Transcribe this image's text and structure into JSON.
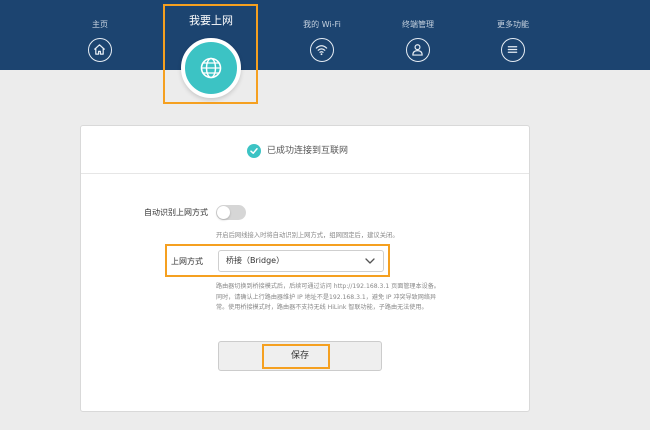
{
  "nav": {
    "items": [
      {
        "label": "主页",
        "icon": "home-icon"
      },
      {
        "label": "我的 Wi-Fi",
        "icon": "wifi-icon"
      },
      {
        "label": "终端管理",
        "icon": "user-icon"
      },
      {
        "label": "更多功能",
        "icon": "menu-icon"
      }
    ],
    "active": {
      "label": "我要上网",
      "icon": "globe-icon"
    }
  },
  "status": {
    "text": "已成功连接到互联网",
    "icon": "check-circle-icon"
  },
  "auto_detect": {
    "label": "自动识别上网方式",
    "enabled": false,
    "hint": "开启后网线接入时将自动识别上网方式，组网固定后，建议关闭。"
  },
  "mode": {
    "label": "上网方式",
    "selected": "桥接（Bridge）"
  },
  "bridge_note": {
    "lines": [
      "路由器切换到桥接模式后，后续可通过访问 http://192.168.3.1 页面管理本设备。",
      "同时，请确认上行路由器维护 IP 地址不是192.168.3.1，避免 IP 冲突导致网络异",
      "常。使用桥接模式时，路由器不支持无线 HiLink 智联功能，子路由无法使用。"
    ]
  },
  "save_label": "保存",
  "colors": {
    "header": "#1c4470",
    "accent": "#3cc3c4",
    "highlight": "#f5a020"
  }
}
